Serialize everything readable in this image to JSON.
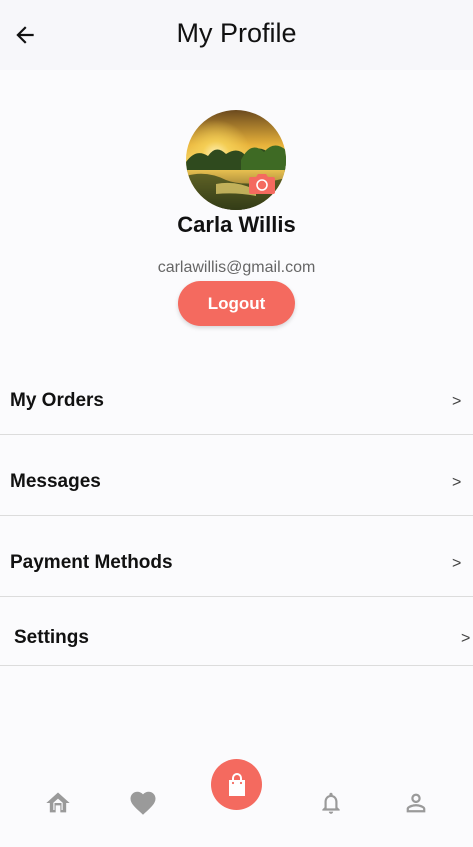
{
  "header": {
    "title": "My Profile",
    "back_icon": "arrow-left-icon"
  },
  "profile": {
    "name": "Carla Willis",
    "email": "carlawillis@gmail.com",
    "logout_label": "Logout",
    "camera_icon": "camera-icon"
  },
  "menu": {
    "items": [
      {
        "label": "My Orders",
        "chevron": ">"
      },
      {
        "label": "Messages",
        "chevron": ">"
      },
      {
        "label": "Payment Methods",
        "chevron": ">"
      },
      {
        "label": "Settings",
        "chevron": ">"
      }
    ]
  },
  "bottom_nav": {
    "items": [
      "home-icon",
      "heart-icon",
      "shopping-bag-icon",
      "bell-icon",
      "person-icon"
    ]
  },
  "colors": {
    "accent": "#f46a5f",
    "background": "#fbfbfd",
    "header_bg": "#f7f7fa",
    "icon_gray": "#9a9a9a",
    "divider": "#dcdcdc"
  }
}
